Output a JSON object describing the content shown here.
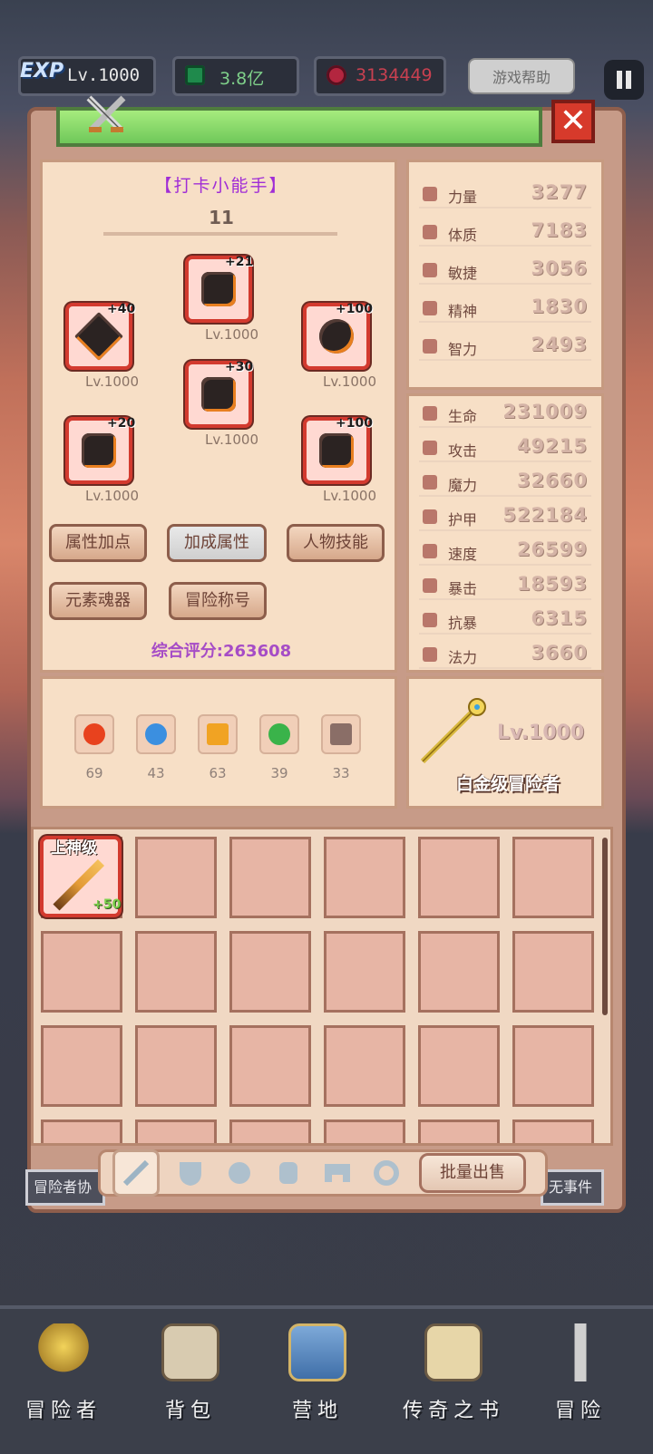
{
  "topbar": {
    "exp_label": "EXP",
    "level": "Lv.1000",
    "emerald_value": "3.8亿",
    "ruby_value": "3134449",
    "help_label": "游戏帮助",
    "colors": {
      "emerald": "#7fd08a",
      "ruby": "#c94050"
    }
  },
  "character": {
    "title": "【打卡小能手】",
    "number": "11",
    "equipment": [
      {
        "plus": "+21",
        "level": "Lv.1000",
        "icon": "helmet-icon"
      },
      {
        "plus": "+40",
        "level": "Lv.1000",
        "icon": "sword-icon"
      },
      {
        "plus": "+100",
        "level": "Lv.1000",
        "icon": "orb-icon"
      },
      {
        "plus": "+30",
        "level": "Lv.1000",
        "icon": "armor-icon"
      },
      {
        "plus": "+20",
        "level": "Lv.1000",
        "icon": "glove-icon"
      },
      {
        "plus": "+100",
        "level": "Lv.1000",
        "icon": "boots-icon"
      }
    ],
    "buttons": [
      "属性加点",
      "加成属性",
      "人物技能",
      "元素魂器",
      "冒险称号"
    ],
    "score": "综合评分:263608",
    "elements": [
      {
        "value": "69",
        "icon": "fire-element-icon",
        "color": "#e8421e"
      },
      {
        "value": "43",
        "icon": "water-element-icon",
        "color": "#3b8fe0"
      },
      {
        "value": "63",
        "icon": "lightning-element-icon",
        "color": "#f1a323"
      },
      {
        "value": "39",
        "icon": "wind-element-icon",
        "color": "#3ab34a"
      },
      {
        "value": "33",
        "icon": "dark-element-icon",
        "color": "#8a6e67"
      }
    ]
  },
  "base_stats": [
    {
      "name": "力量",
      "value": "3277"
    },
    {
      "name": "体质",
      "value": "7183"
    },
    {
      "name": "敏捷",
      "value": "3056"
    },
    {
      "name": "精神",
      "value": "1830"
    },
    {
      "name": "智力",
      "value": "2493"
    }
  ],
  "combat_stats": [
    {
      "name": "生命",
      "value": "231009"
    },
    {
      "name": "攻击",
      "value": "49215"
    },
    {
      "name": "魔力",
      "value": "32660"
    },
    {
      "name": "护甲",
      "value": "522184"
    },
    {
      "name": "速度",
      "value": "26599"
    },
    {
      "name": "暴击",
      "value": "18593"
    },
    {
      "name": "抗暴",
      "value": "6315"
    },
    {
      "name": "法力",
      "value": "3660"
    }
  ],
  "rank": {
    "level": "Lv.1000",
    "name": "白金级冒险者"
  },
  "inventory": {
    "item": {
      "grade": "上神级",
      "plus": "+50"
    },
    "bulk_sell": "批量出售",
    "tabs": [
      "weapon-tab-icon",
      "shield-tab-icon",
      "helmet-tab-icon",
      "armor-tab-icon",
      "belt-tab-icon",
      "ring-tab-icon"
    ]
  },
  "side_labels": {
    "left": "冒险者协",
    "right": "无事件"
  },
  "nav": [
    "冒险者",
    "背包",
    "营地",
    "传奇之书",
    "冒险"
  ]
}
